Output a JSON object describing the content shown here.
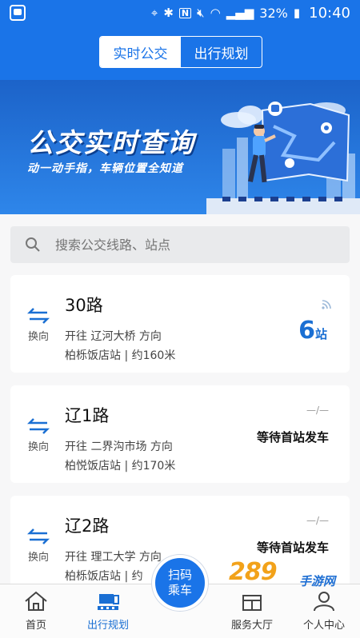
{
  "status_bar": {
    "battery": "32%",
    "time": "10:40"
  },
  "header": {
    "tabs": [
      {
        "label": "实时公交",
        "active": true
      },
      {
        "label": "出行规划",
        "active": false
      }
    ]
  },
  "banner": {
    "title": "公交实时查询",
    "subtitle": "动一动手指，车辆位置全知道"
  },
  "search": {
    "placeholder": "搜索公交线路、站点"
  },
  "routes": [
    {
      "swap_label": "换向",
      "name": "30路",
      "direction": "开往 辽河大桥 方向",
      "stop": "柏栎饭店站 | 约160米",
      "eta_number": "6",
      "eta_unit": "站"
    },
    {
      "swap_label": "换向",
      "name": "辽1路",
      "direction": "开往 二界沟市场 方向",
      "stop": "柏悦饭店站 | 约170米",
      "eta_dash": "—/—",
      "eta_text": "等待首站发车"
    },
    {
      "swap_label": "换向",
      "name": "辽2路",
      "direction": "开往 理工大学 方向",
      "stop": "柏栎饭店站 | 约",
      "eta_dash": "—/—",
      "eta_text": "等待首站发车"
    }
  ],
  "bottom_nav": {
    "items": [
      {
        "label": "首页",
        "icon": "home-icon"
      },
      {
        "label": "出行规划",
        "icon": "route-plan-icon",
        "active": true
      },
      {
        "label": "服务大厅",
        "icon": "service-hall-icon"
      },
      {
        "label": "个人中心",
        "icon": "profile-icon"
      }
    ],
    "scan_line1": "扫码",
    "scan_line2": "乘车"
  },
  "watermark": {
    "main": "289",
    "sub": "手游网"
  },
  "colors": {
    "primary": "#1a74e8",
    "eta_blue": "#1a6fd3",
    "watermark_orange": "#f2a21a"
  }
}
